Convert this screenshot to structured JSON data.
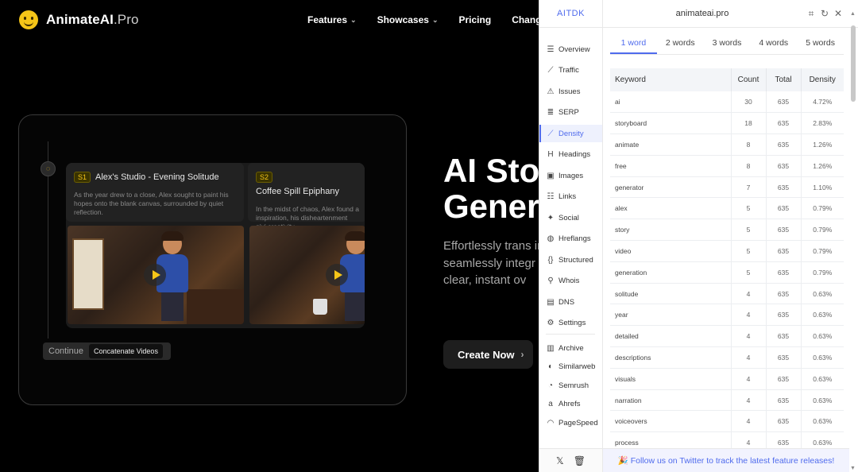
{
  "site": {
    "logo": {
      "name": "AnimateAI",
      "suffix": ".Pro"
    },
    "nav": [
      {
        "label": "Features",
        "dropdown": true
      },
      {
        "label": "Showcases",
        "dropdown": true
      },
      {
        "label": "Pricing",
        "dropdown": false
      },
      {
        "label": "Changelog",
        "dropdown": false
      }
    ],
    "scenes": [
      {
        "tag": "S1",
        "title": "Alex's Studio - Evening Solitude",
        "desc": "As the year drew to a close, Alex sought to paint his hopes onto the blank canvas, surrounded by quiet reflection."
      },
      {
        "tag": "S2",
        "title": "Coffee Spill Epiphany",
        "desc": "In the midst of chaos, Alex found a inspiration, his disheartenment givi creativity."
      }
    ],
    "continue_label": "Continue",
    "concat_label": "Concatenate Videos",
    "hero_title_1": "AI Sto",
    "hero_title_2": "Gener",
    "hero_sub": "Effortlessly trans in minutes. With s seamlessly integr stories, refine sce a clear, instant ov",
    "cta_label": "Create Now"
  },
  "panel": {
    "brand": "AITDK",
    "domain": "animateai.pro",
    "sidebar": [
      {
        "label": "Overview",
        "icon": "list-icon",
        "glyph": "☰"
      },
      {
        "label": "Traffic",
        "icon": "chart-line-icon",
        "glyph": "⟋"
      },
      {
        "label": "Issues",
        "icon": "warning-icon",
        "glyph": "⚠"
      },
      {
        "label": "SERP",
        "icon": "serp-icon",
        "glyph": "≣"
      },
      {
        "label": "Density",
        "icon": "density-icon",
        "glyph": "⟋",
        "active": true
      },
      {
        "label": "Headings",
        "icon": "heading-icon",
        "glyph": "H"
      },
      {
        "label": "Images",
        "icon": "image-icon",
        "glyph": "▣"
      },
      {
        "label": "Links",
        "icon": "links-icon",
        "glyph": "☷"
      },
      {
        "label": "Social",
        "icon": "twitter-icon",
        "glyph": "✦"
      },
      {
        "label": "Hreflangs",
        "icon": "globe-icon",
        "glyph": "◍"
      },
      {
        "label": "Structured",
        "icon": "braces-icon",
        "glyph": "{}"
      },
      {
        "label": "Whois",
        "icon": "user-search-icon",
        "glyph": "⚲"
      },
      {
        "label": "DNS",
        "icon": "dns-icon",
        "glyph": "▤"
      },
      {
        "label": "Settings",
        "icon": "gear-icon",
        "glyph": "⚙"
      }
    ],
    "tools": [
      {
        "label": "Archive",
        "icon": "archive-icon",
        "glyph": "▥"
      },
      {
        "label": "Similarweb",
        "icon": "similarweb-icon",
        "glyph": "◐"
      },
      {
        "label": "Semrush",
        "icon": "semrush-icon",
        "glyph": "◔"
      },
      {
        "label": "Ahrefs",
        "icon": "ahrefs-icon",
        "glyph": "a"
      },
      {
        "label": "PageSpeed",
        "icon": "speed-icon",
        "glyph": "◠"
      }
    ],
    "tabs": [
      "1 word",
      "2 words",
      "3 words",
      "4 words",
      "5 words"
    ],
    "active_tab": 0,
    "columns": [
      "Keyword",
      "Count",
      "Total",
      "Density"
    ],
    "rows": [
      [
        "ai",
        "30",
        "635",
        "4.72%"
      ],
      [
        "storyboard",
        "18",
        "635",
        "2.83%"
      ],
      [
        "animate",
        "8",
        "635",
        "1.26%"
      ],
      [
        "free",
        "8",
        "635",
        "1.26%"
      ],
      [
        "generator",
        "7",
        "635",
        "1.10%"
      ],
      [
        "alex",
        "5",
        "635",
        "0.79%"
      ],
      [
        "story",
        "5",
        "635",
        "0.79%"
      ],
      [
        "video",
        "5",
        "635",
        "0.79%"
      ],
      [
        "generation",
        "5",
        "635",
        "0.79%"
      ],
      [
        "solitude",
        "4",
        "635",
        "0.63%"
      ],
      [
        "year",
        "4",
        "635",
        "0.63%"
      ],
      [
        "detailed",
        "4",
        "635",
        "0.63%"
      ],
      [
        "descriptions",
        "4",
        "635",
        "0.63%"
      ],
      [
        "visuals",
        "4",
        "635",
        "0.63%"
      ],
      [
        "narration",
        "4",
        "635",
        "0.63%"
      ],
      [
        "voiceovers",
        "4",
        "635",
        "0.63%"
      ],
      [
        "process",
        "4",
        "635",
        "0.63%"
      ]
    ],
    "footer_msg": "🎉 Follow us on Twitter to track the latest feature releases!",
    "accent": "#4f6bed"
  }
}
